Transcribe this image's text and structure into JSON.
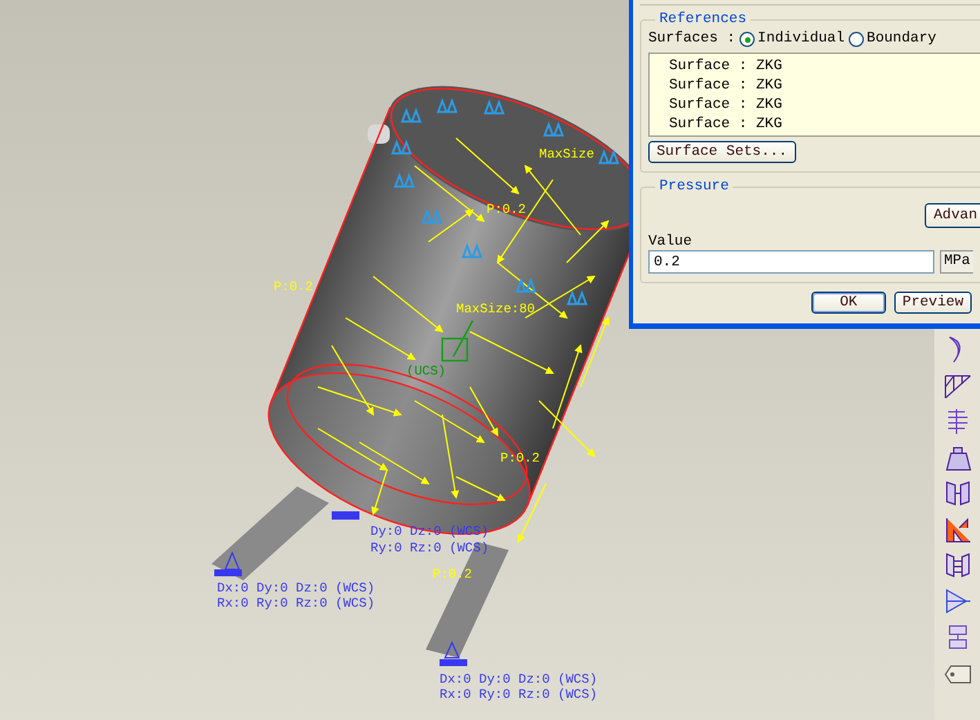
{
  "model": {
    "labels": [
      {
        "kind": "mesh",
        "text": "MaxSize"
      },
      {
        "kind": "load",
        "text": "P:0.2"
      },
      {
        "kind": "load",
        "text": "P:0.2"
      },
      {
        "kind": "mesh",
        "text": "MaxSize:80"
      },
      {
        "kind": "csys",
        "text": "(UCS)"
      },
      {
        "kind": "load",
        "text": "P:0.2"
      },
      {
        "kind": "constraint",
        "text": "Dy:0 Dz:0 (WCS)"
      },
      {
        "kind": "constraint",
        "text": "Ry:0 Rz:0 (WCS)"
      },
      {
        "kind": "load",
        "text": "P:0.2"
      },
      {
        "kind": "constraint",
        "text": "Dx:0 Dy:0 Dz:0 (WCS)"
      },
      {
        "kind": "constraint",
        "text": "Rx:0 Ry:0 Rz:0 (WCS)"
      },
      {
        "kind": "constraint",
        "text": "Dx:0 Dy:0 Dz:0 (WCS)"
      },
      {
        "kind": "constraint",
        "text": "Rx:0 Ry:0 Rz:0 (WCS)"
      }
    ]
  },
  "dialog": {
    "references": {
      "title": "References",
      "surfaces_label": "Surfaces :",
      "options": [
        {
          "label": "Individual",
          "selected": true
        },
        {
          "label": "Boundary",
          "selected": false
        }
      ],
      "list": [
        "Surface : ZKG",
        "Surface : ZKG",
        "Surface : ZKG",
        "Surface : ZKG"
      ],
      "button": "Surface Sets..."
    },
    "pressure": {
      "title": "Pressure",
      "advanced_button": "Advan",
      "value_label": "Value",
      "value": "0.2",
      "unit": "MPa"
    },
    "buttons": [
      "OK",
      "Preview"
    ]
  }
}
